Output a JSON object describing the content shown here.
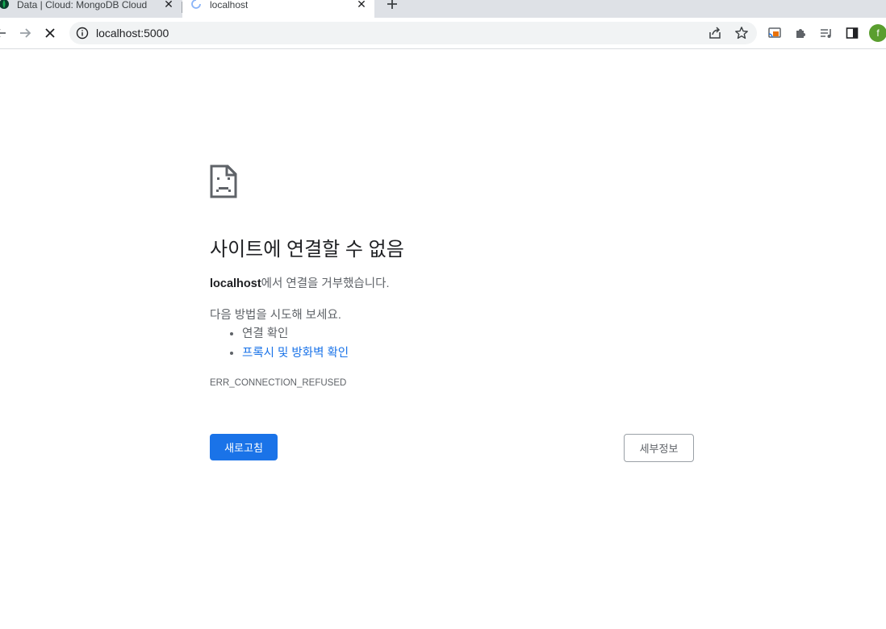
{
  "browser": {
    "tabs": [
      {
        "title": "Data | Cloud: MongoDB Cloud",
        "icon": "mongodb-leaf-icon",
        "active": false
      },
      {
        "title": "localhost",
        "icon": "loading-spinner-icon",
        "active": true
      }
    ],
    "new_tab_icon": "plus-icon",
    "close_tab_icon": "close-icon",
    "address": "localhost:5000",
    "toolbar_icons": [
      "back-arrow-icon",
      "forward-arrow-icon",
      "stop-loading-icon",
      "info-icon",
      "share-icon",
      "star-icon",
      "cast-icon",
      "extensions-icon",
      "media-queue-icon",
      "side-panel-icon"
    ],
    "profile_initial": "f",
    "profile_color": "#5a9e2e"
  },
  "error_page": {
    "icon": "sad-page-icon",
    "heading": "사이트에 연결할 수 없음",
    "host": "localhost",
    "message_suffix": "에서 연결을 거부했습니다.",
    "try_label": "다음 방법을 시도해 보세요.",
    "suggestions": [
      {
        "text": "연결 확인",
        "link": false
      },
      {
        "text": "프록시 및 방화벽 확인",
        "link": true
      }
    ],
    "error_code": "ERR_CONNECTION_REFUSED",
    "reload_label": "새로고침",
    "details_label": "세부정보"
  },
  "colors": {
    "accent": "#1a73e8",
    "tabstrip": "#dee1e6",
    "omnibox": "#f1f3f4",
    "text_secondary": "#5f6368"
  }
}
